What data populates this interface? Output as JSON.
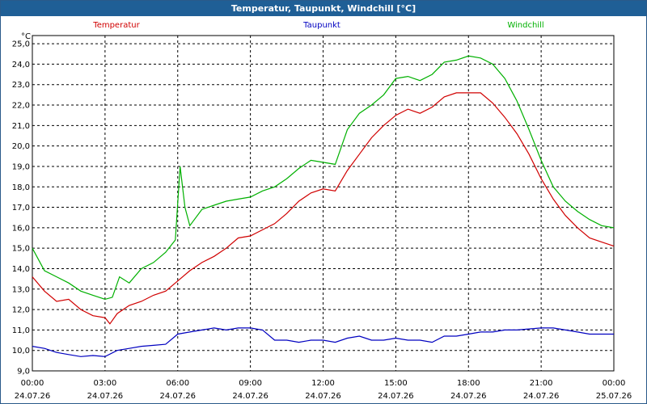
{
  "window": {
    "title": "Temperatur, Taupunkt, Windchill [°C]"
  },
  "colors": {
    "temperatur": "#d00000",
    "taupunkt": "#0000c0",
    "windchill": "#00b000",
    "titlebar": "#1f5f96"
  },
  "chart_data": {
    "type": "line",
    "title": "Temperatur, Taupunkt, Windchill [°C]",
    "ylabel": "°C",
    "xlabel": "",
    "ylim": [
      9.0,
      25.4
    ],
    "xlim": [
      0,
      24
    ],
    "grid": true,
    "legend_placement": "top",
    "y_ticks": [
      "9,0",
      "10,0",
      "11,0",
      "12,0",
      "13,0",
      "14,0",
      "15,0",
      "16,0",
      "17,0",
      "18,0",
      "19,0",
      "20,0",
      "21,0",
      "22,0",
      "23,0",
      "24,0",
      "25,0"
    ],
    "y_tick_values": [
      9,
      10,
      11,
      12,
      13,
      14,
      15,
      16,
      17,
      18,
      19,
      20,
      21,
      22,
      23,
      24,
      25
    ],
    "x_ticks": [
      {
        "time": "00:00",
        "date": "24.07.26",
        "hour": 0
      },
      {
        "time": "03:00",
        "date": "24.07.26",
        "hour": 3
      },
      {
        "time": "06:00",
        "date": "24.07.26",
        "hour": 6
      },
      {
        "time": "09:00",
        "date": "24.07.26",
        "hour": 9
      },
      {
        "time": "12:00",
        "date": "24.07.26",
        "hour": 12
      },
      {
        "time": "15:00",
        "date": "24.07.26",
        "hour": 15
      },
      {
        "time": "18:00",
        "date": "24.07.26",
        "hour": 18
      },
      {
        "time": "21:00",
        "date": "24.07.26",
        "hour": 21
      },
      {
        "time": "00:00",
        "date": "25.07.26",
        "hour": 24
      }
    ],
    "series": [
      {
        "name": "Temperatur",
        "color": "#d00000",
        "points": [
          [
            0,
            13.6
          ],
          [
            0.5,
            12.9
          ],
          [
            1,
            12.4
          ],
          [
            1.5,
            12.5
          ],
          [
            2,
            12.0
          ],
          [
            2.5,
            11.7
          ],
          [
            3,
            11.6
          ],
          [
            3.2,
            11.3
          ],
          [
            3.5,
            11.8
          ],
          [
            4,
            12.2
          ],
          [
            4.5,
            12.4
          ],
          [
            5,
            12.7
          ],
          [
            5.5,
            12.9
          ],
          [
            6,
            13.4
          ],
          [
            6.5,
            13.9
          ],
          [
            7,
            14.3
          ],
          [
            7.5,
            14.6
          ],
          [
            8,
            15.0
          ],
          [
            8.5,
            15.5
          ],
          [
            9,
            15.6
          ],
          [
            9.5,
            15.9
          ],
          [
            10,
            16.2
          ],
          [
            10.5,
            16.7
          ],
          [
            11,
            17.3
          ],
          [
            11.5,
            17.7
          ],
          [
            12,
            17.9
          ],
          [
            12.5,
            17.8
          ],
          [
            13,
            18.8
          ],
          [
            13.5,
            19.6
          ],
          [
            14,
            20.4
          ],
          [
            14.5,
            21.0
          ],
          [
            15,
            21.5
          ],
          [
            15.5,
            21.8
          ],
          [
            16,
            21.6
          ],
          [
            16.5,
            21.9
          ],
          [
            17,
            22.4
          ],
          [
            17.5,
            22.6
          ],
          [
            18,
            22.6
          ],
          [
            18.5,
            22.6
          ],
          [
            19,
            22.1
          ],
          [
            19.5,
            21.4
          ],
          [
            20,
            20.6
          ],
          [
            20.5,
            19.6
          ],
          [
            21,
            18.4
          ],
          [
            21.5,
            17.4
          ],
          [
            22,
            16.6
          ],
          [
            22.5,
            16.0
          ],
          [
            23,
            15.5
          ],
          [
            23.5,
            15.3
          ],
          [
            24,
            15.1
          ]
        ]
      },
      {
        "name": "Taupunkt",
        "color": "#0000c0",
        "points": [
          [
            0,
            10.2
          ],
          [
            0.5,
            10.1
          ],
          [
            1,
            9.9
          ],
          [
            1.5,
            9.8
          ],
          [
            2,
            9.7
          ],
          [
            2.5,
            9.75
          ],
          [
            3,
            9.7
          ],
          [
            3.5,
            10.0
          ],
          [
            4,
            10.1
          ],
          [
            4.5,
            10.2
          ],
          [
            5,
            10.25
          ],
          [
            5.5,
            10.3
          ],
          [
            6,
            10.8
          ],
          [
            6.5,
            10.9
          ],
          [
            7,
            11.0
          ],
          [
            7.5,
            11.1
          ],
          [
            8,
            11.0
          ],
          [
            8.5,
            11.1
          ],
          [
            9,
            11.1
          ],
          [
            9.5,
            11.0
          ],
          [
            10,
            10.5
          ],
          [
            10.5,
            10.5
          ],
          [
            11,
            10.4
          ],
          [
            11.5,
            10.5
          ],
          [
            12,
            10.5
          ],
          [
            12.5,
            10.4
          ],
          [
            13,
            10.6
          ],
          [
            13.5,
            10.7
          ],
          [
            14,
            10.5
          ],
          [
            14.5,
            10.5
          ],
          [
            15,
            10.6
          ],
          [
            15.5,
            10.5
          ],
          [
            16,
            10.5
          ],
          [
            16.5,
            10.4
          ],
          [
            17,
            10.7
          ],
          [
            17.5,
            10.7
          ],
          [
            18,
            10.8
          ],
          [
            18.5,
            10.9
          ],
          [
            19,
            10.9
          ],
          [
            19.5,
            11.0
          ],
          [
            20,
            11.0
          ],
          [
            20.5,
            11.05
          ],
          [
            21,
            11.1
          ],
          [
            21.5,
            11.1
          ],
          [
            22,
            11.0
          ],
          [
            22.5,
            10.9
          ],
          [
            23,
            10.8
          ],
          [
            23.5,
            10.8
          ],
          [
            24,
            10.8
          ]
        ]
      },
      {
        "name": "Windchill",
        "color": "#00b000",
        "points": [
          [
            0,
            15.0
          ],
          [
            0.5,
            13.9
          ],
          [
            1,
            13.6
          ],
          [
            1.5,
            13.3
          ],
          [
            2,
            12.9
          ],
          [
            2.5,
            12.7
          ],
          [
            3,
            12.5
          ],
          [
            3.3,
            12.6
          ],
          [
            3.6,
            13.6
          ],
          [
            4,
            13.3
          ],
          [
            4.5,
            14.0
          ],
          [
            5,
            14.3
          ],
          [
            5.5,
            14.8
          ],
          [
            5.9,
            15.4
          ],
          [
            6.1,
            19.0
          ],
          [
            6.3,
            17.0
          ],
          [
            6.5,
            16.1
          ],
          [
            7,
            16.9
          ],
          [
            7.5,
            17.1
          ],
          [
            8,
            17.3
          ],
          [
            8.5,
            17.4
          ],
          [
            9,
            17.5
          ],
          [
            9.5,
            17.8
          ],
          [
            10,
            18.0
          ],
          [
            10.5,
            18.4
          ],
          [
            11,
            18.9
          ],
          [
            11.5,
            19.3
          ],
          [
            12,
            19.2
          ],
          [
            12.5,
            19.1
          ],
          [
            13,
            20.8
          ],
          [
            13.5,
            21.6
          ],
          [
            14,
            22.0
          ],
          [
            14.5,
            22.5
          ],
          [
            15,
            23.3
          ],
          [
            15.5,
            23.4
          ],
          [
            16,
            23.2
          ],
          [
            16.5,
            23.5
          ],
          [
            17,
            24.1
          ],
          [
            17.5,
            24.2
          ],
          [
            18,
            24.4
          ],
          [
            18.5,
            24.3
          ],
          [
            19,
            24.0
          ],
          [
            19.5,
            23.3
          ],
          [
            20,
            22.2
          ],
          [
            20.5,
            20.8
          ],
          [
            21,
            19.3
          ],
          [
            21.5,
            18.0
          ],
          [
            22,
            17.3
          ],
          [
            22.5,
            16.8
          ],
          [
            23,
            16.4
          ],
          [
            23.5,
            16.1
          ],
          [
            24,
            16.0
          ]
        ]
      }
    ]
  }
}
